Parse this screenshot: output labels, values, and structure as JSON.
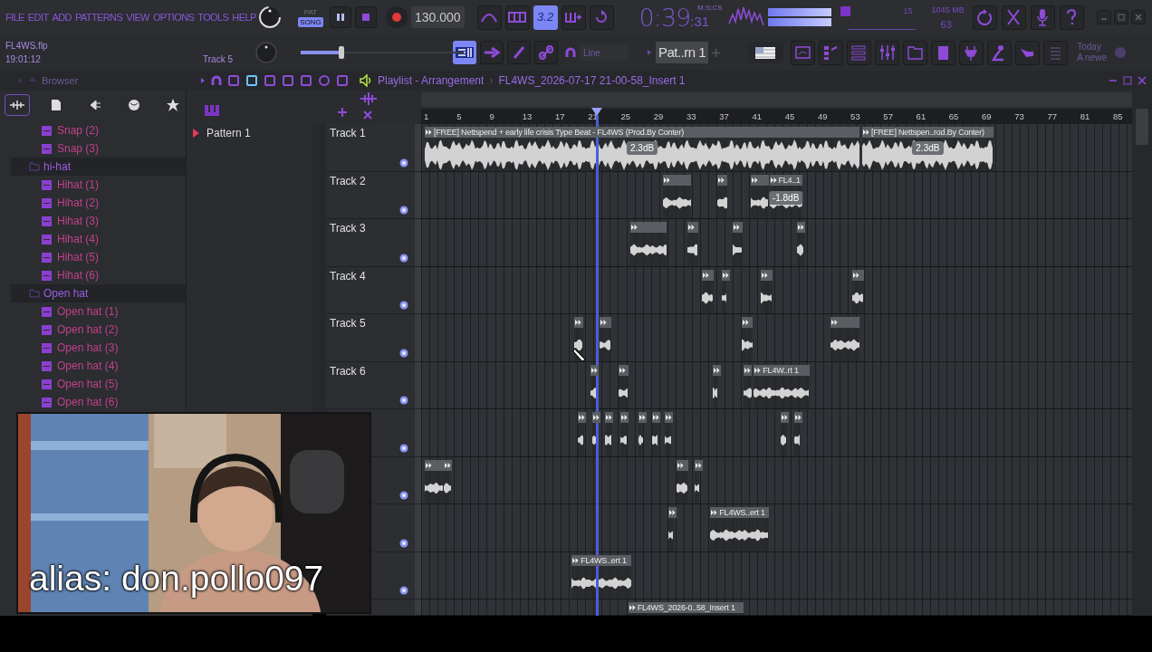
{
  "menu": [
    "FILE",
    "EDIT",
    "ADD",
    "PATTERNS",
    "VIEW",
    "OPTIONS",
    "TOOLS",
    "HELP"
  ],
  "transport": {
    "modes": [
      {
        "label": "PAT",
        "selected": false
      },
      {
        "label": "SONG",
        "selected": true
      }
    ],
    "playing": true,
    "tempo": "130.000"
  },
  "tool_buttons": [
    {
      "selected": false
    },
    {
      "selected": false
    },
    {
      "label": "3.2",
      "selected": true
    },
    {
      "selected": false
    },
    {
      "selected": false
    }
  ],
  "clock": {
    "time": "0:39",
    "centis": ":31",
    "format": "M:S:CS"
  },
  "monitor": {
    "cpu": "15",
    "memory": "1045 MB",
    "polyphony": "63"
  },
  "project": {
    "file": "FL4WS.flp",
    "elapsed": "19:01:12",
    "hint": "Track 5"
  },
  "master_pitch": {
    "level": 0.25
  },
  "view_buttons": [
    {
      "selected": true
    },
    {
      "selected": false
    },
    {
      "selected": false
    },
    {
      "selected": false
    }
  ],
  "snap": "Line",
  "pattern_selector": "Pat..rn 1",
  "news": {
    "line_1": "Today",
    "line_2": "A newe"
  },
  "browser": {
    "title": "Browser",
    "tabs": [
      {
        "selected": true
      },
      {
        "selected": false
      },
      {
        "selected": false
      },
      {
        "selected": false
      },
      {
        "selected": false
      }
    ],
    "tree": [
      {
        "label": "Snap (2)",
        "kind": "sample"
      },
      {
        "label": "Snap (3)",
        "kind": "sample"
      },
      {
        "label": "hi-hat",
        "kind": "folder",
        "children": [
          {
            "label": "Hihat (1)",
            "kind": "sample"
          },
          {
            "label": "Hihat (2)",
            "kind": "sample"
          },
          {
            "label": "Hihat (3)",
            "kind": "sample"
          },
          {
            "label": "Hihat (4)",
            "kind": "sample"
          },
          {
            "label": "Hihat (5)",
            "kind": "sample"
          },
          {
            "label": "Hihat (6)",
            "kind": "sample"
          }
        ]
      },
      {
        "label": "Open hat",
        "kind": "folder",
        "children": [
          {
            "label": "Open hat (1)",
            "kind": "sample"
          },
          {
            "label": "Open hat (2)",
            "kind": "sample"
          },
          {
            "label": "Open hat (3)",
            "kind": "sample"
          },
          {
            "label": "Open hat (4)",
            "kind": "sample"
          },
          {
            "label": "Open hat (5)",
            "kind": "sample"
          },
          {
            "label": "Open hat (6)",
            "kind": "sample"
          }
        ]
      }
    ]
  },
  "playlist": {
    "title": "Playlist - Arrangement",
    "separator": "›",
    "arrangement": "FL4WS_2026-07-17 21-00-58_Insert 1",
    "patterns": [
      "Pattern 1"
    ],
    "ruler": [
      "1",
      "5",
      "9",
      "13",
      "17",
      "21",
      "25",
      "29",
      "33",
      "37",
      "41",
      "45",
      "49",
      "53",
      "57",
      "61",
      "65",
      "69",
      "73",
      "77",
      "81",
      "85"
    ],
    "tracks": [
      {
        "name": "Track 1",
        "enabled": true,
        "clips": [
          {
            "label": "[FREE] Nettspend + early life crisis Type Beat - FL4WS (Prod.By Conter)",
            "gain": "2.3dB"
          },
          {
            "label": "[FREE] Nettspen..rod.By Conter)",
            "gain": "2.3dB"
          }
        ]
      },
      {
        "name": "Track 2",
        "enabled": true,
        "clips": [
          {
            "label": "FL4..1",
            "gain": "-1.8dB"
          }
        ]
      },
      {
        "name": "Track 3",
        "enabled": true
      },
      {
        "name": "Track 4",
        "enabled": true
      },
      {
        "name": "Track 5",
        "enabled": true
      },
      {
        "name": "Track 6",
        "enabled": true,
        "clips": [
          {
            "label": "FL4W..rt 1"
          }
        ]
      },
      {
        "enabled": true
      },
      {
        "enabled": true
      },
      {
        "enabled": true,
        "clips": [
          {
            "label": "FL4WS..ert 1"
          }
        ]
      },
      {
        "enabled": true,
        "clips": [
          {
            "label": "FL4WS..ert 1"
          }
        ]
      },
      {
        "clips": [
          {
            "label": "FL4WS_2026-0..58_Insert 1"
          }
        ]
      }
    ]
  },
  "webcam": {
    "kind": "picture",
    "caption": "alias: don.pollo097"
  }
}
